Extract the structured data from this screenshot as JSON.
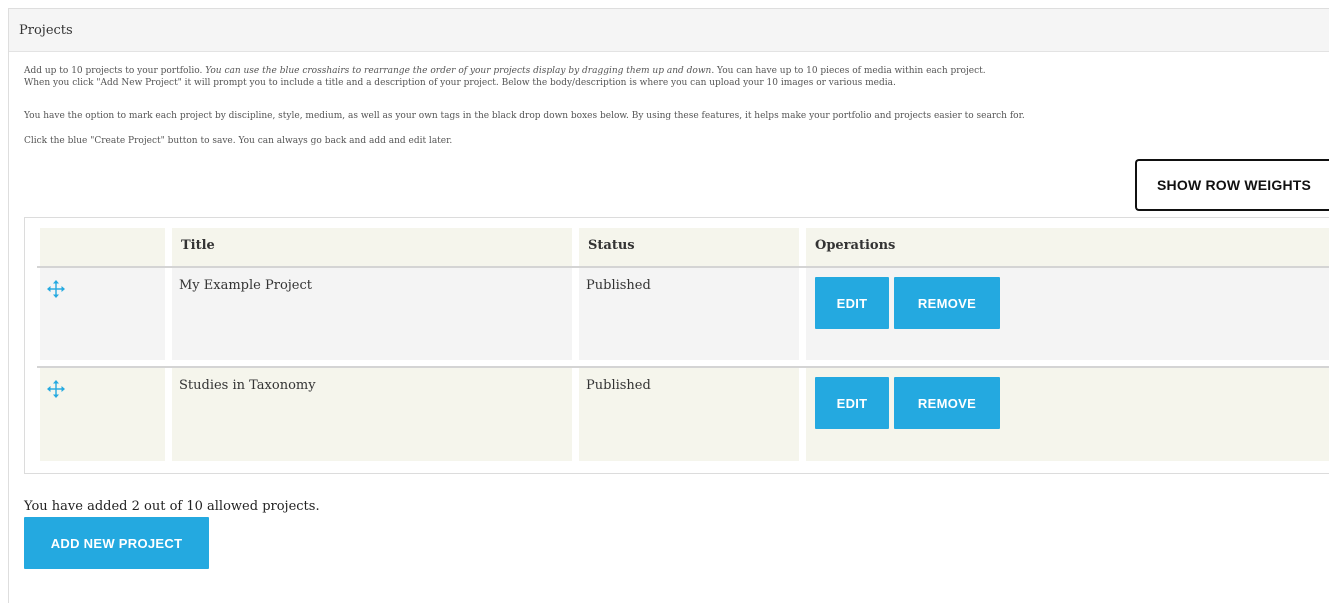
{
  "panel": {
    "title": "Projects"
  },
  "intro": {
    "line1_start": "Add up to 10 projects to your portfolio. ",
    "line1_em": "You can use the blue crosshairs to rearrange the order of your projects display by dragging them up and down.",
    "line1_end": " You can have up to 10 pieces of media within each project.",
    "line2": "When you click \"Add New Project\" it will prompt you to include a title and a description of your project. Below the body/description is where you can upload your 10 images or various media.",
    "line3": "You have the option to mark each project by discipline, style, medium, as well as your own tags in the black drop down boxes below. By using these features, it helps make your portfolio and projects easier to search for.",
    "line4": "Click the blue \"Create Project\" button to save. You can always go back and add and edit later."
  },
  "toolbar": {
    "show_row_weights": "SHOW ROW WEIGHTS"
  },
  "table": {
    "columns": [
      "",
      "Title",
      "Status",
      "Operations"
    ],
    "rows": [
      {
        "title": "My Example Project",
        "status": "Published",
        "edit_label": "EDIT",
        "remove_label": "REMOVE"
      },
      {
        "title": "Studies in Taxonomy",
        "status": "Published",
        "edit_label": "EDIT",
        "remove_label": "REMOVE"
      }
    ]
  },
  "footer": {
    "count_text": "You have added 2 out of 10 allowed projects.",
    "add_button": "ADD NEW PROJECT"
  },
  "colors": {
    "accent": "#24a9e0",
    "header_bg": "#f5f5ec",
    "row_alt_bg": "#f4f4f4"
  },
  "icons": {
    "drag_handle": "move-crosshair-icon"
  }
}
